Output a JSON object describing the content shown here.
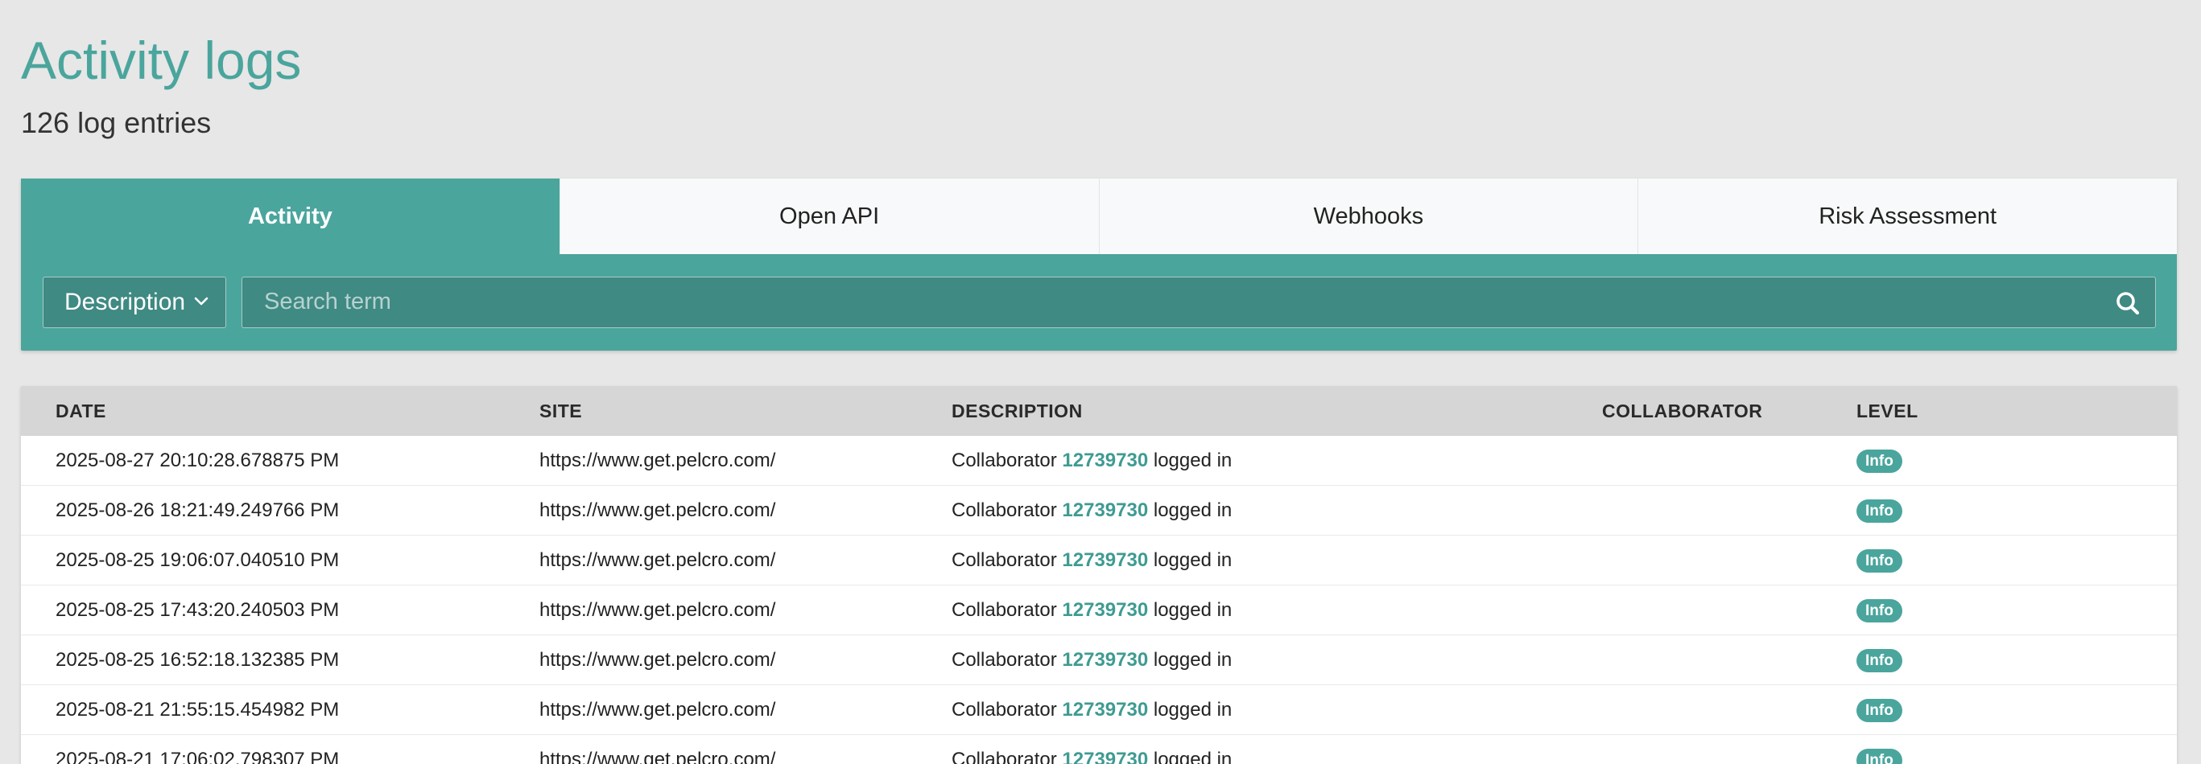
{
  "page": {
    "title": "Activity logs",
    "entry_count": "126 log entries"
  },
  "tabs": [
    {
      "label": "Activity",
      "active": true
    },
    {
      "label": "Open API",
      "active": false
    },
    {
      "label": "Webhooks",
      "active": false
    },
    {
      "label": "Risk Assessment",
      "active": false
    }
  ],
  "filter": {
    "selected": "Description",
    "icon": "chevron-down-icon"
  },
  "search": {
    "placeholder": "Search term",
    "value": "",
    "icon": "search-icon"
  },
  "table": {
    "columns": [
      "DATE",
      "SITE",
      "DESCRIPTION",
      "COLLABORATOR",
      "LEVEL"
    ],
    "rows": [
      {
        "date": "2025-08-27 20:10:28.678875 PM",
        "site": "https://www.get.pelcro.com/",
        "desc_prefix": "Collaborator",
        "desc_id": "12739730",
        "desc_suffix": "logged in",
        "collaborator": "",
        "level": "Info"
      },
      {
        "date": "2025-08-26 18:21:49.249766 PM",
        "site": "https://www.get.pelcro.com/",
        "desc_prefix": "Collaborator",
        "desc_id": "12739730",
        "desc_suffix": "logged in",
        "collaborator": "",
        "level": "Info"
      },
      {
        "date": "2025-08-25 19:06:07.040510 PM",
        "site": "https://www.get.pelcro.com/",
        "desc_prefix": "Collaborator",
        "desc_id": "12739730",
        "desc_suffix": "logged in",
        "collaborator": "",
        "level": "Info"
      },
      {
        "date": "2025-08-25 17:43:20.240503 PM",
        "site": "https://www.get.pelcro.com/",
        "desc_prefix": "Collaborator",
        "desc_id": "12739730",
        "desc_suffix": "logged in",
        "collaborator": "",
        "level": "Info"
      },
      {
        "date": "2025-08-25 16:52:18.132385 PM",
        "site": "https://www.get.pelcro.com/",
        "desc_prefix": "Collaborator",
        "desc_id": "12739730",
        "desc_suffix": "logged in",
        "collaborator": "",
        "level": "Info"
      },
      {
        "date": "2025-08-21 21:55:15.454982 PM",
        "site": "https://www.get.pelcro.com/",
        "desc_prefix": "Collaborator",
        "desc_id": "12739730",
        "desc_suffix": "logged in",
        "collaborator": "",
        "level": "Info"
      },
      {
        "date": "2025-08-21 17:06:02.798307 PM",
        "site": "https://www.get.pelcro.com/",
        "desc_prefix": "Collaborator",
        "desc_id": "12739730",
        "desc_suffix": "logged in",
        "collaborator": "",
        "level": "Info"
      }
    ]
  },
  "colors": {
    "accent": "#4aa59d",
    "accent_dark": "#3f8a83",
    "background": "#e6e7e6",
    "table_header": "#d5d6d5"
  }
}
